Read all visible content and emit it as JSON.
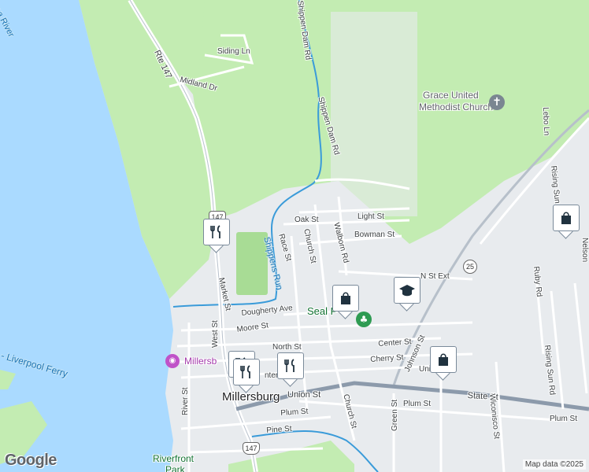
{
  "colors": {
    "water": "#aadaff",
    "park": "#c3ecb2",
    "land": "#e8ebee",
    "road": "#ffffff",
    "highway": "#8c9aab",
    "river_blue": "#3a9bd9"
  },
  "roads": {
    "rte147": "Rte 147",
    "market_st": "Market St",
    "siding_ln": "Siding Ln",
    "midland_dr": "Midland Dr",
    "shippen_dam_rd_1": "Shippen Dam Rd",
    "shippen_dam_rd_2": "Shippen Dam Rd",
    "oak_st": "Oak St",
    "light_st": "Light St",
    "bowman_st": "Bowman St",
    "race_st": "Race St",
    "church_st": "Church St",
    "walborn_rd": "Walborn Rd",
    "n_st_ext": "N St Ext",
    "dougherty_ave": "Dougherty Ave",
    "moore_st": "Moore St",
    "north_st": "North St",
    "center_st": "Center St",
    "cherry_st": "Cherry St",
    "johnson_st": "Johnson St",
    "union_st": "Union St",
    "state_st": "State St",
    "plum_st_1": "Plum St",
    "plum_st_2": "Plum St",
    "plum_st_3": "Plum St",
    "pine_st": "Pine St",
    "church_st_2": "Church St",
    "green_st": "Green St",
    "wiconisco_st": "Wiconisco St",
    "rising_sun_rd": "Rising Sun Rd",
    "rising_sun_top": "Rising Sun",
    "ruby_rd": "Ruby Rd",
    "lebo_ln": "Lebo Ln",
    "nelson": "Nelson",
    "river_st": "River St",
    "west_st": "West St",
    "union_partial": "Uni",
    "center_partial": "nter St"
  },
  "water_labels": {
    "river": "nna River",
    "shippens_run": "Shippens Run"
  },
  "places": {
    "grace_church_line1": "Grace United",
    "grace_church_line2": "Methodist Church",
    "seal_park": "Seal P",
    "ferry": "g - Liverpool Ferry",
    "ferry_poi": "Millersb",
    "riverfront_1": "Riverfront",
    "riverfront_2": "Park",
    "town": "Millersburg",
    "route_shield_1": "147",
    "route_shield_2": "147",
    "route_shield_3": "25"
  },
  "icons": [
    "shopping-bag-icon",
    "restaurant-icon",
    "school-icon",
    "church-icon",
    "park-icon",
    "camera-icon"
  ],
  "footer": {
    "logo": "Google",
    "attribution": "Map data ©2025"
  }
}
